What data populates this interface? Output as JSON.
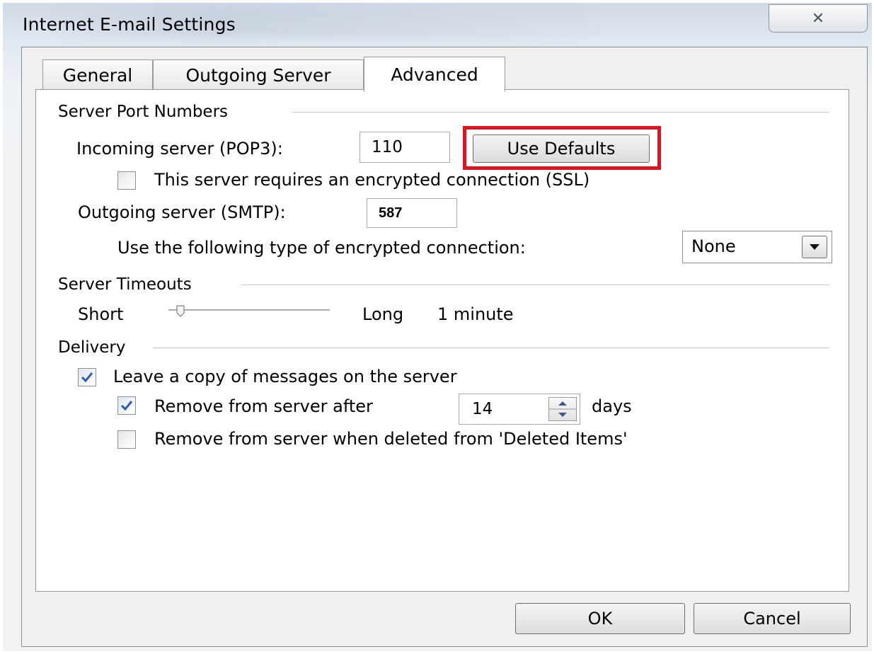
{
  "window": {
    "title": "Internet E-mail Settings",
    "close_glyph": "✕"
  },
  "tabs": [
    {
      "label": "General",
      "selected": false
    },
    {
      "label": "Outgoing Server",
      "selected": false
    },
    {
      "label": "Advanced",
      "selected": true
    }
  ],
  "server_ports": {
    "section_label": "Server Port Numbers",
    "incoming_label": "Incoming server (POP3):",
    "incoming_value": "110",
    "use_defaults_label": "Use Defaults",
    "ssl_checkbox_label": "This server requires an encrypted connection (SSL)",
    "ssl_checked": false,
    "outgoing_label": "Outgoing server (SMTP):",
    "outgoing_value": "587",
    "encryption_label": "Use the following type of encrypted connection:",
    "encryption_value": "None"
  },
  "timeouts": {
    "section_label": "Server Timeouts",
    "short_label": "Short",
    "long_label": "Long",
    "value_text": "1 minute",
    "slider_level": 0.1
  },
  "delivery": {
    "section_label": "Delivery",
    "leave_copy_label": "Leave a copy of messages on the server",
    "leave_copy_checked": true,
    "remove_after_label": "Remove from server after",
    "remove_after_checked": true,
    "days_value": "14",
    "days_label": "days",
    "remove_deleted_label": "Remove from server when deleted from 'Deleted Items'",
    "remove_deleted_checked": false
  },
  "buttons": {
    "ok": "OK",
    "cancel": "Cancel"
  },
  "colors": {
    "highlight": "#e0141e",
    "check": "#2a5fb0"
  },
  "icons": {
    "close": "close-icon",
    "dropdown": "chevron-down-icon",
    "spinner": "spinner-arrows-icon",
    "check": "checkmark-icon"
  }
}
